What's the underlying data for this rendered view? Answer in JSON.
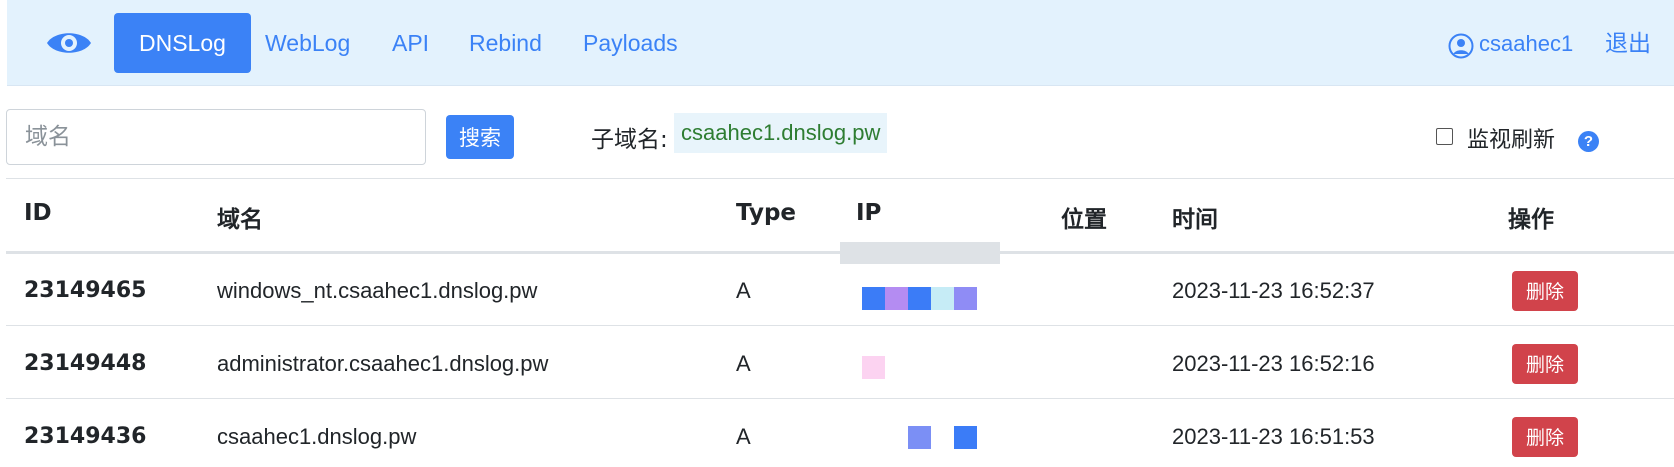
{
  "navbar": {
    "items": [
      {
        "label": "DNSLog",
        "active": true
      },
      {
        "label": "WebLog",
        "active": false
      },
      {
        "label": "API",
        "active": false
      },
      {
        "label": "Rebind",
        "active": false
      },
      {
        "label": "Payloads",
        "active": false
      }
    ],
    "username": "csaahec1",
    "logout_label": "退出",
    "logo_icon": "eye-icon",
    "user_icon": "user-circle-icon"
  },
  "search": {
    "placeholder": "域名",
    "value": "",
    "button_label": "搜索"
  },
  "subdomain": {
    "label": "子域名:",
    "value": "csaahec1.dnslog.pw"
  },
  "monitor": {
    "label": "监视刷新",
    "checked": false,
    "help_icon": "question-circle-icon",
    "help_glyph": "?"
  },
  "table": {
    "headers": {
      "id": "ID",
      "domain": "域名",
      "type": "Type",
      "ip": "IP",
      "location": "位置",
      "time": "时间",
      "action": "操作"
    },
    "rows": [
      {
        "id": "23149465",
        "domain": "windows_nt.csaahec1.dnslog.pw",
        "type": "A",
        "ip_redacted_colors": [
          "#3b7cf7",
          "#b48cf2",
          "#3b7cf7",
          "#c6ecf6",
          "#8f8cf5"
        ],
        "location": "",
        "time": "2023-11-23 16:52:37",
        "action_label": "删除"
      },
      {
        "id": "23149448",
        "domain": "administrator.csaahec1.dnslog.pw",
        "type": "A",
        "ip_redacted_colors": [
          "#fcd3f1"
        ],
        "location": "",
        "time": "2023-11-23 16:52:16",
        "action_label": "删除"
      },
      {
        "id": "23149436",
        "domain": "csaahec1.dnslog.pw",
        "type": "A",
        "ip_redacted_colors": [
          "#7b8ff5",
          "#3b7cf7"
        ],
        "location": "",
        "time": "2023-11-23 16:51:53",
        "action_label": "删除"
      }
    ]
  },
  "colors": {
    "primary": "#3b82f6",
    "navbar_bg": "#e3f2fd",
    "danger": "#d1434b",
    "subdomain_text": "#2e7d32"
  }
}
